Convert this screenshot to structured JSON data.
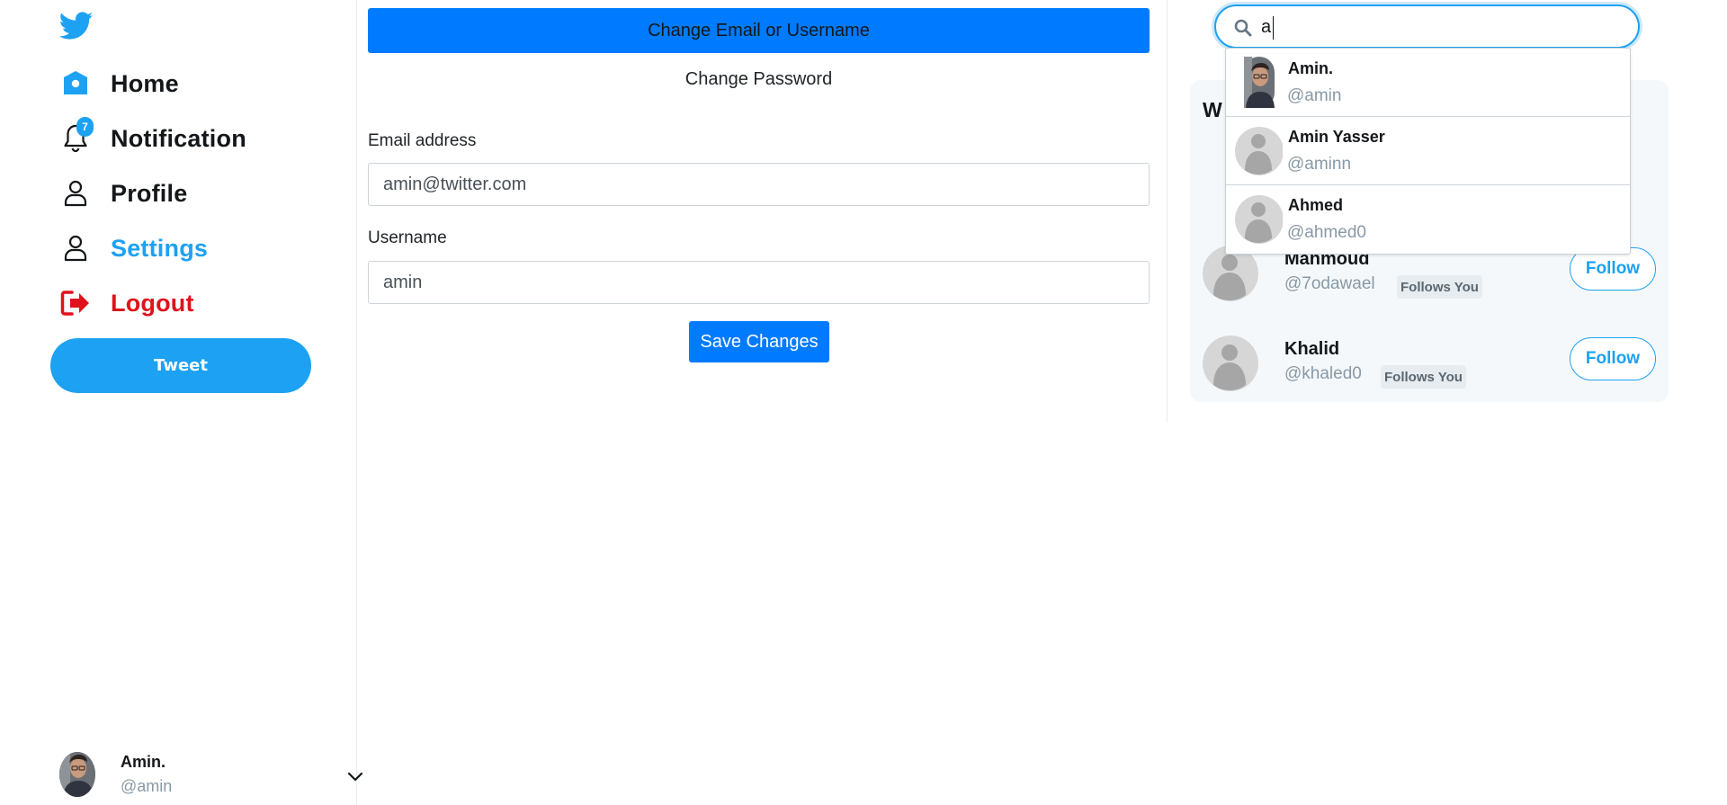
{
  "colors": {
    "brand": "#1da1f2",
    "primary_button": "#007bff",
    "logout": "#e0121b",
    "muted": "#8899a6"
  },
  "sidebar": {
    "logo_icon": "twitter-bird-icon",
    "nav": [
      {
        "label": "Home",
        "icon": "home-icon"
      },
      {
        "label": "Notification",
        "icon": "bell-icon",
        "badge": "7"
      },
      {
        "label": "Profile",
        "icon": "user-icon"
      },
      {
        "label": "Settings",
        "icon": "user-icon",
        "active": true
      },
      {
        "label": "Logout",
        "icon": "logout-icon"
      }
    ],
    "tweet_label": "Tweet",
    "account": {
      "name": "Amin.",
      "handle": "@amin"
    }
  },
  "settings": {
    "tab_email_label": "Change Email or Username",
    "tab_password_label": "Change Password",
    "email_label": "Email address",
    "email_value": "amin@twitter.com",
    "username_label": "Username",
    "username_value": "amin",
    "save_label": "Save Changes"
  },
  "search": {
    "value": "a",
    "results": [
      {
        "name": "Amin.",
        "handle": "@amin"
      },
      {
        "name": "Amin Yasser",
        "handle": "@aminn"
      },
      {
        "name": "Ahmed",
        "handle": "@ahmed0"
      }
    ]
  },
  "who_to_follow": {
    "title_visible": "W",
    "users": [
      {
        "name": "Mahmoud",
        "handle": "@7odawael",
        "tag": "Follows You",
        "button": "Follow"
      },
      {
        "name": "Khalid",
        "handle": "@khaled0",
        "tag": "Follows You",
        "button": "Follow"
      }
    ]
  }
}
